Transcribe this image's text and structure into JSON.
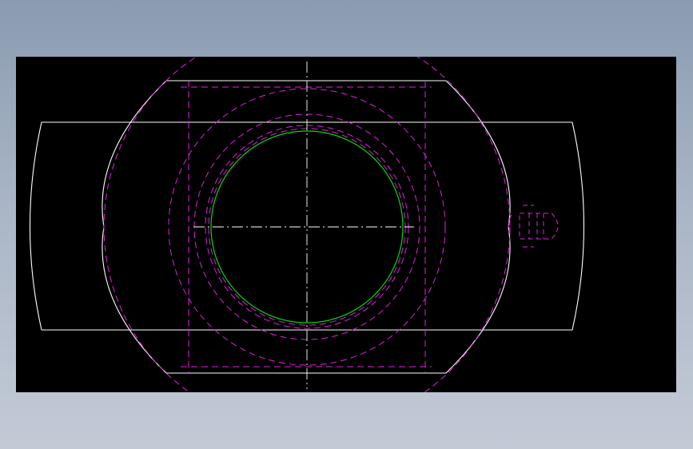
{
  "drawing": {
    "background": "#000000",
    "colors": {
      "outline": "#ffffff",
      "hidden": "#e020e0",
      "bore": "#00dd00",
      "centerline": "#ffffff"
    },
    "linetypes": {
      "outline": "continuous",
      "hidden": "dashed",
      "bore": "continuous",
      "centerline": "dash-dot"
    }
  }
}
